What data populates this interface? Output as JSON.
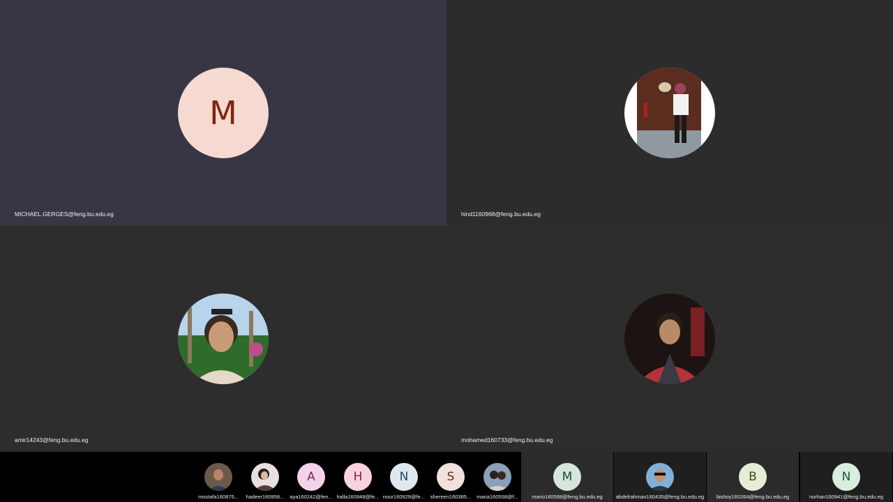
{
  "main_tiles": [
    {
      "name": "MICHAEL.GERGES@feng.bu.edu.eg",
      "initial": "M"
    },
    {
      "name": "hind1160968@feng.bu.edu.eg"
    },
    {
      "name": "amir14243@feng.bu.edu.eg"
    },
    {
      "name": "mohamed160733@feng.bu.edu.eg"
    }
  ],
  "strip_tiles": [
    {
      "name": "mostafa160875..."
    },
    {
      "name": "hadeer160958..."
    },
    {
      "name": "aya160242@fen...",
      "initial": "A"
    },
    {
      "name": "halla160948@fe...",
      "initial": "H"
    },
    {
      "name": "nour160929@fe...",
      "initial": "N"
    },
    {
      "name": "shereen160385...",
      "initial": "S"
    },
    {
      "name": "maria160558@f..."
    },
    {
      "name": "mario160568@feng.bu.edu.eg",
      "initial": "M"
    },
    {
      "name": "abdelrahman160435@feng.bu.edu.eg"
    },
    {
      "name": "bishoy160264@feng.bu.edu.eg",
      "initial": "B"
    },
    {
      "name": "norhan160941@feng.bu.edu.eg",
      "initial": "N"
    }
  ],
  "colors": {
    "tile_active": "#373645",
    "tile_default": "#2d2d2d",
    "strip_background": "#000000"
  }
}
